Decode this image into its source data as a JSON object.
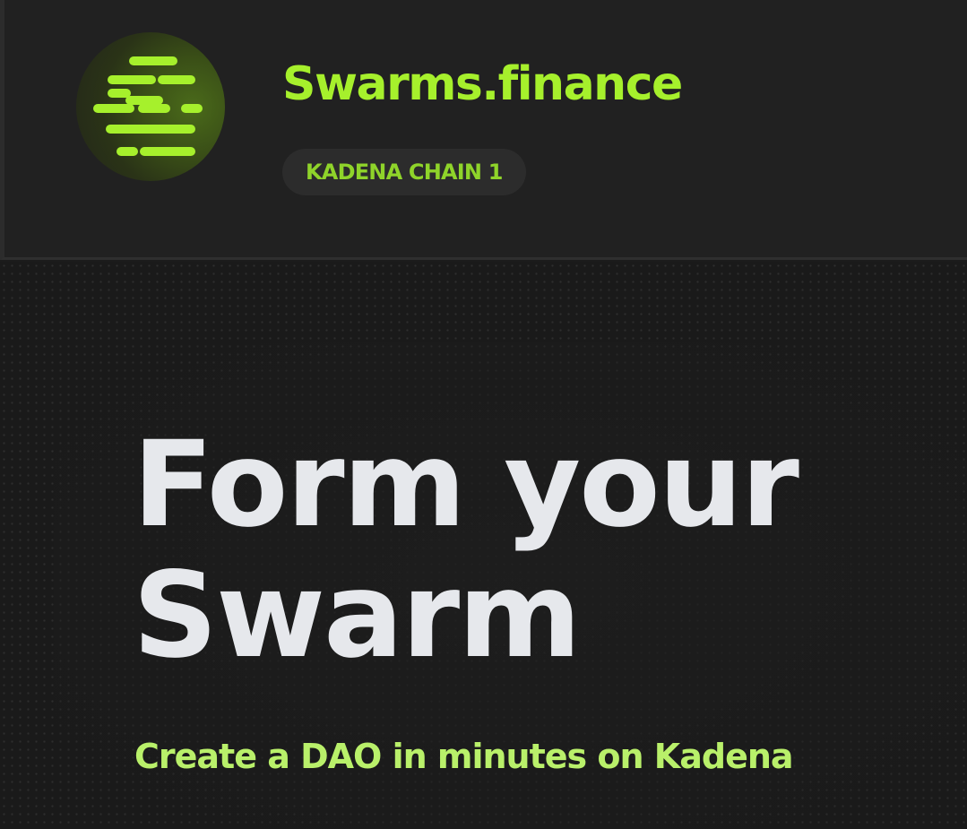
{
  "header": {
    "logo_icon": "swarm-lines-icon",
    "brand_name": "Swarms.finance",
    "chain_badge": "KADENA CHAIN 1"
  },
  "hero": {
    "title_line1": "Form your",
    "title_line2": "Swarm",
    "subtitle": "Create a DAO in minutes on Kadena"
  },
  "colors": {
    "accent": "#a6f02c",
    "badge_text": "#8fd42a",
    "subtitle": "#b9f06a",
    "title": "#e6e8ec",
    "background": "#1a1a1a",
    "header_background": "#212121"
  }
}
